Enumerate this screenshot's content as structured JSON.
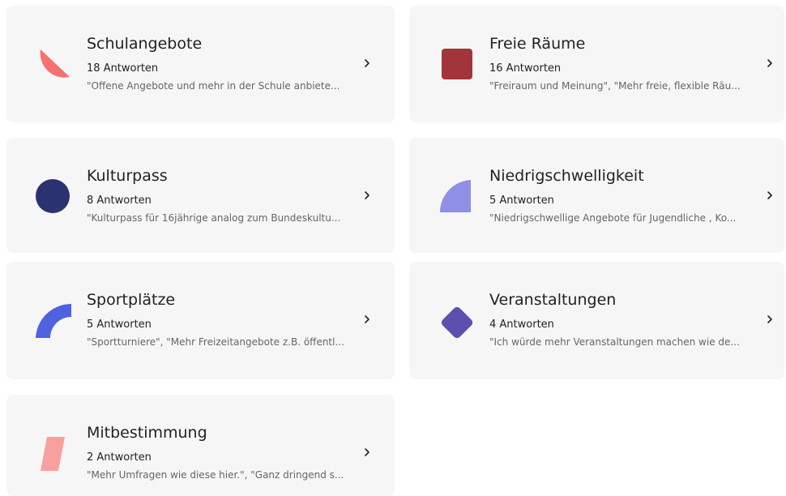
{
  "cards": [
    {
      "title": "Schulangebote",
      "count": "18 Antworten",
      "quote": "\"Offene Angebote und mehr in der Schule anbiete...",
      "shape": "half-circle-icon",
      "color": "#f87171"
    },
    {
      "title": "Freie Räume",
      "count": "16 Antworten",
      "quote": "\"Freiraum und Meinung\", \"Mehr freie, flexible Räu...",
      "shape": "rounded-square-icon",
      "color": "#a3343a"
    },
    {
      "title": "Kulturpass",
      "count": "8 Antworten",
      "quote": "\"Kulturpass für 16jährige analog zum Bundeskultu...",
      "shape": "circle-icon",
      "color": "#2b3272"
    },
    {
      "title": "Niedrigschwelligkeit",
      "count": "5 Antworten",
      "quote": "\"Niedrigschwellige Angebote für Jugendliche , Ko...",
      "shape": "quarter-circle-icon",
      "color": "#8f8fe6"
    },
    {
      "title": "Sportplätze",
      "count": "5 Antworten",
      "quote": "\"Sportturniere\", \"Mehr Freizeitangebote z.B. öffentl...",
      "shape": "arc-icon",
      "color": "#4f63e0"
    },
    {
      "title": "Veranstaltungen",
      "count": "4 Antworten",
      "quote": "\"Ich würde mehr Veranstaltungen machen wie de...",
      "shape": "diamond-icon",
      "color": "#5b4fb0"
    },
    {
      "title": "Mitbestimmung",
      "count": "2 Antworten",
      "quote": "\"Mehr Umfragen wie diese hier.\", \"Ganz dringend s...",
      "shape": "parallelogram-icon",
      "color": "#f8a0a0"
    }
  ]
}
